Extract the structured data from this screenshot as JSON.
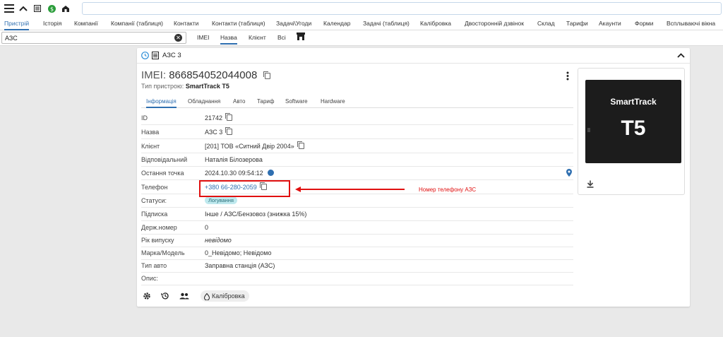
{
  "nav": {
    "tabs": [
      "Пристрій",
      "Історія",
      "Компанії",
      "Компанії (таблиця)",
      "Контакти",
      "Контакти (таблиця)",
      "Задачі\\Угоди",
      "Календар",
      "Задачі (таблиця)",
      "Калібровка",
      "Двосторонній дзвінок",
      "Склад",
      "Тарифи",
      "Акаунти",
      "Форми",
      "Всплываючі вікна"
    ]
  },
  "filter": {
    "value": "АЗС",
    "tabs": [
      "IMEI",
      "Назва",
      "Клієнт",
      "Всі"
    ]
  },
  "card": {
    "title": "АЗС 3",
    "imei_label": "IMEI:",
    "imei_value": "866854052044008",
    "device_type_label": "Тип пристрою:",
    "device_type_value": "SmartTrack T5",
    "tabs": [
      "Інформація",
      "Обладнання",
      "Авто",
      "Тариф",
      "Software",
      "Hardware"
    ],
    "fields": {
      "id": {
        "label": "ID",
        "value": "21742"
      },
      "name": {
        "label": "Назва",
        "value": "АЗС 3"
      },
      "client": {
        "label": "Клієнт",
        "value": "[201] ТОВ «Ситний Двір 2004»"
      },
      "responsible": {
        "label": "Відповідальний",
        "value": "Наталія Білозерова"
      },
      "last_point": {
        "label": "Остання точка",
        "value": "2024.10.30 09:54:12"
      },
      "phone": {
        "label": "Телефон",
        "value": "+380 66-280-2059"
      },
      "statuses": {
        "label": "Статуси:",
        "value": "Логування"
      },
      "subscription": {
        "label": "Підписка",
        "value": "Інше / АЗС/Бензовоз (знижка 15%)"
      },
      "plate": {
        "label": "Держ.номер",
        "value": "0"
      },
      "year": {
        "label": "Рік випуску",
        "value": "невідомо"
      },
      "brand_model": {
        "label": "Марка/Модель",
        "value": "0_Невідомо; Невідомо"
      },
      "vehicle_type": {
        "label": "Тип авто",
        "value": "Заправна станція (АЗС)"
      },
      "description": {
        "label": "Опис:",
        "value": ""
      }
    },
    "footer": {
      "calibration_label": "Калібровка"
    },
    "device_image": {
      "brand": "SmartTrack",
      "model": "T5"
    }
  },
  "annotation": {
    "text": "Номер телефону АЗС"
  },
  "colors": {
    "accent": "#2f6fb0",
    "annotation": "#e01010",
    "status_chip": "#bfe9ee"
  }
}
